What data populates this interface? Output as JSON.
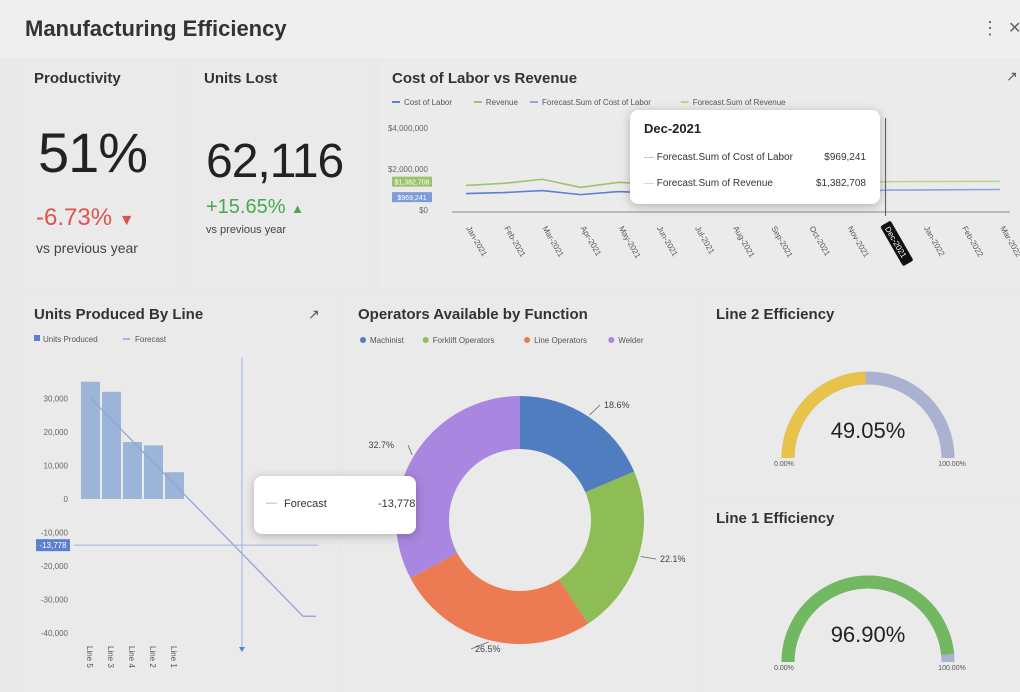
{
  "header": {
    "title": "Manufacturing Efficiency",
    "menu_icon": "more-vertical-icon",
    "close_icon": "close-icon"
  },
  "productivity": {
    "title": "Productivity",
    "value": "51%",
    "change": "-6.73%",
    "compare": "vs previous year",
    "change_color": "#e0524f"
  },
  "units_lost": {
    "title": "Units Lost",
    "value": "62,116",
    "change": "+15.65%",
    "compare": "vs previous year",
    "change_color": "#4aa84f"
  },
  "labor": {
    "title": "Cost of Labor vs Revenue",
    "legend": [
      "Cost of Labor",
      "Revenue",
      "Forecast.Sum of Cost of Labor",
      "Forecast.Sum of Revenue"
    ],
    "y_ticks": [
      "$4,000,000",
      "$2,000,000",
      "$0"
    ],
    "y_highlight": [
      "$1,382,708",
      "$969,241"
    ],
    "x_ticks": [
      "Jan-2021",
      "Feb-2021",
      "Mar-2021",
      "Apr-2021",
      "May-2021",
      "Jun-2021",
      "Jul-2021",
      "Aug-2021",
      "Sep-2021",
      "Oct-2021",
      "Nov-2021",
      "Dec-2021",
      "Jan-2022",
      "Feb-2022",
      "Mar-2022"
    ],
    "tooltip": {
      "title": "Dec-2021",
      "rows": [
        {
          "label": "Forecast.Sum of Cost of Labor",
          "value": "$969,241"
        },
        {
          "label": "Forecast.Sum of Revenue",
          "value": "$1,382,708"
        }
      ]
    }
  },
  "units_produced": {
    "title": "Units Produced By Line",
    "legend": [
      "Units Produced",
      "Forecast"
    ],
    "y_ticks": [
      "30,000",
      "20,000",
      "10,000",
      "0",
      "-10,000",
      "-20,000",
      "-30,000",
      "-40,000"
    ],
    "y_highlight": "-13,778",
    "tooltip": {
      "label": "Forecast",
      "value": "-13,778"
    }
  },
  "operators": {
    "title": "Operators Available by Function",
    "legend": [
      "Machinist",
      "Forklift Operators",
      "Line Operators",
      "Welder"
    ]
  },
  "line2": {
    "title": "Line 2 Efficiency",
    "value": "49.05%",
    "min": "0.00%",
    "max": "100.00%",
    "fraction": 0.4905
  },
  "line1": {
    "title": "Line 1 Efficiency",
    "value": "96.90%",
    "min": "0.00%",
    "max": "100.00%",
    "fraction": 0.969
  },
  "chart_data": [
    {
      "type": "line",
      "title": "Cost of Labor vs Revenue",
      "x": [
        "Jan-2021",
        "Feb-2021",
        "Mar-2021",
        "Apr-2021",
        "May-2021",
        "Jun-2021",
        "Jul-2021",
        "Aug-2021",
        "Sep-2021",
        "Oct-2021",
        "Nov-2021",
        "Dec-2021",
        "Jan-2022",
        "Feb-2022",
        "Mar-2022"
      ],
      "series": [
        {
          "name": "Cost of Labor",
          "values": [
            800000,
            850000,
            950000,
            750000,
            900000,
            820000,
            860000,
            880000,
            840000,
            900000,
            870000,
            null,
            null,
            null,
            null
          ],
          "color": "#5b7fd1"
        },
        {
          "name": "Revenue",
          "values": [
            1200000,
            1300000,
            1500000,
            1100000,
            1350000,
            1250000,
            1300000,
            1320000,
            1280000,
            1350000,
            1330000,
            null,
            null,
            null,
            null
          ],
          "color": "#9cc36a"
        },
        {
          "name": "Forecast.Sum of Cost of Labor",
          "values": [
            null,
            null,
            null,
            null,
            null,
            null,
            null,
            null,
            null,
            null,
            870000,
            969241,
            980000,
            990000,
            1000000
          ],
          "color": "#8fa5dd"
        },
        {
          "name": "Forecast.Sum of Revenue",
          "values": [
            null,
            null,
            null,
            null,
            null,
            null,
            null,
            null,
            null,
            null,
            1330000,
            1382708,
            1390000,
            1395000,
            1400000
          ],
          "color": "#b9d78f"
        }
      ],
      "ylim": [
        0,
        4000000
      ]
    },
    {
      "type": "bar",
      "title": "Units Produced By Line",
      "categories": [
        "Line 5",
        "Line 3",
        "Line 4",
        "Line 2",
        "Line 1"
      ],
      "series": [
        {
          "name": "Units Produced",
          "values": [
            35000,
            32000,
            17000,
            16000,
            8000
          ],
          "color": "#9bb4d8"
        }
      ],
      "forecast": {
        "name": "Forecast",
        "x_start": 0.5,
        "y_start": 30000,
        "x_end": 6.5,
        "y_end": -35000
      },
      "ylim": [
        -40000,
        40000
      ]
    },
    {
      "type": "pie",
      "title": "Operators Available by Function",
      "categories": [
        "Machinist",
        "Forklift Operators",
        "Line Operators",
        "Welder"
      ],
      "values": [
        18.6,
        22.1,
        26.5,
        32.7
      ],
      "labels": [
        "18.6%",
        "22.1%",
        "26.5%",
        "32.7%"
      ],
      "colors": [
        "#4f7dbf",
        "#8dbd54",
        "#ec7a52",
        "#a986e0"
      ]
    }
  ]
}
